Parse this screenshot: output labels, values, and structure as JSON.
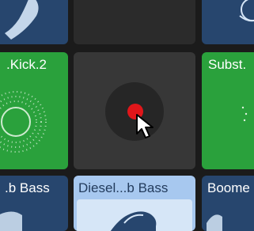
{
  "colors": {
    "background": "#1b1b1b",
    "blue_tile": "#27466e",
    "green_tile": "#2aa13c",
    "dark_tile": "#2c2c2c",
    "selected_tile": "#a7c8ef",
    "record_dot": "#e0161a"
  },
  "pads": {
    "kick": {
      "label": ".Kick.2"
    },
    "subst": {
      "label": "Subst."
    },
    "bass_left": {
      "label": ".b Bass"
    },
    "diesel_bass": {
      "label": "Diesel...b Bass"
    },
    "boom": {
      "label": "Boome"
    }
  },
  "cursor": {
    "icon": "arrow-pointer-icon"
  },
  "record_button": {
    "icon": "record-dot-icon"
  }
}
